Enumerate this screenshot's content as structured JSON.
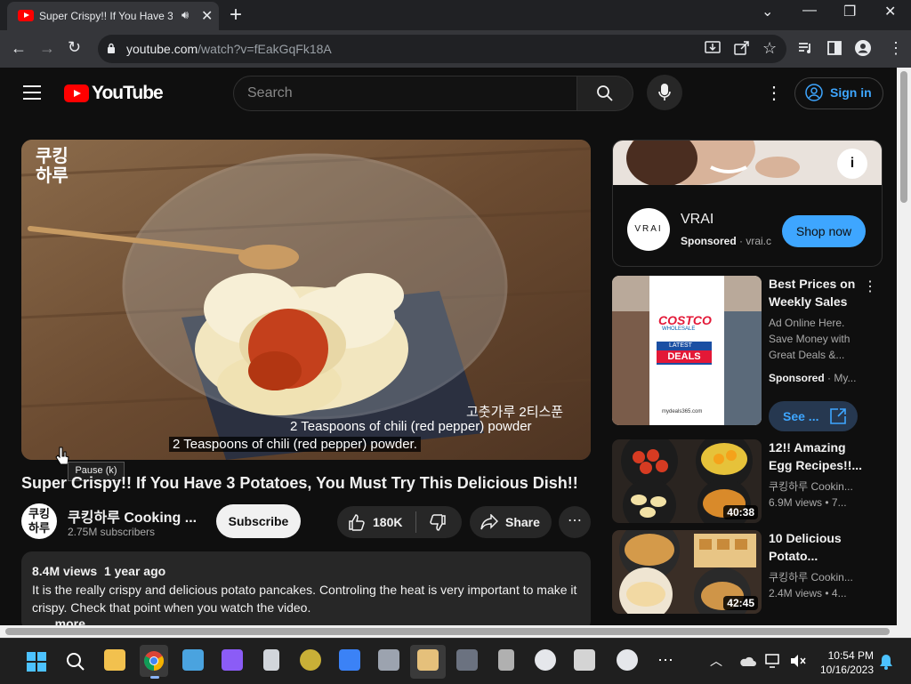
{
  "browser": {
    "tab_title": "Super Crispy!! If You Have 3",
    "url_host": "youtube.com",
    "url_path": "/watch?v=fEakGqFk18A"
  },
  "header": {
    "logo_text": "YouTube",
    "search_placeholder": "Search",
    "signin_label": "Sign in"
  },
  "video": {
    "subtitle_korean": "고춧가루 2티스푼",
    "subtitle_en_1": "2 Teaspoons of  chili (red pepper) powder",
    "subtitle_en_2": "2 Teaspoons of  chili (red pepper) powder.",
    "watermark": "쿠킹\n하루",
    "tooltip": "Pause (k)",
    "title": "Super Crispy!! If You Have 3 Potatoes, You Must Try This Delicious Dish!!"
  },
  "channel": {
    "name": "쿠킹하루 Cooking ...",
    "subscribers": "2.75M subscribers",
    "avatar_text": "쿠킹\n하루",
    "subscribe_label": "Subscribe",
    "likes": "180K",
    "share_label": "Share"
  },
  "description": {
    "views": "8.4M views",
    "age": "1 year ago",
    "text": "It is the really crispy and delicious potato pancakes. Controling the heat is very important to make it crispy. Check that point when you watch the video.",
    "more": "...more"
  },
  "ad": {
    "brand": "VRAI",
    "logo_text": "VRAI",
    "sponsored": "Sponsored",
    "domain": "vrai.c",
    "cta": "Shop now"
  },
  "recommendations": [
    {
      "title": "Best Prices on Weekly Sales",
      "line1": "Ad Online Here.",
      "line2": "Save Money with",
      "line3": "Great Deals &...",
      "sponsored": "Sponsored",
      "by": "My...",
      "cta": "See ...",
      "thumb_brand": "COSTCO",
      "thumb_wholesale": "WHOLESALE",
      "thumb_latest": "LATEST",
      "thumb_deals": "DEALS",
      "thumb_site": "mydeals365.com"
    },
    {
      "title": "12!! Amazing Egg Recipes!!...",
      "channel": "쿠킹하루 Cookin...",
      "views": "6.9M views",
      "age": "7...",
      "duration": "40:38"
    },
    {
      "title": "10 Delicious Potato...",
      "channel": "쿠킹하루 Cookin...",
      "views": "2.4M views",
      "age": "4...",
      "duration": "42:45"
    }
  ],
  "taskbar": {
    "time": "10:54 PM",
    "date": "10/16/2023"
  }
}
